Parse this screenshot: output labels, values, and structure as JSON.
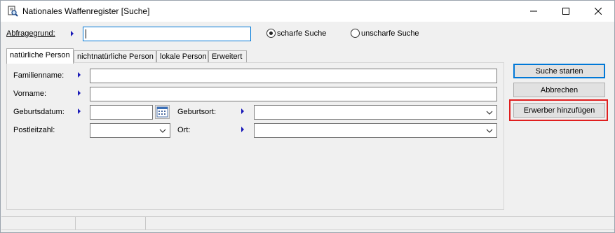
{
  "window": {
    "title": "Nationales Waffenregister [Suche]"
  },
  "query": {
    "label": "Abfragegrund:",
    "value": "",
    "radio_sharp": "scharfe Suche",
    "radio_fuzzy": "unscharfe Suche",
    "selected": "scharfe Suche"
  },
  "tabs": [
    {
      "label": "natürliche Person",
      "active": true
    },
    {
      "label": "nichtnatürliche Person",
      "active": false
    },
    {
      "label": "lokale Person",
      "active": false
    },
    {
      "label": "Erweitert",
      "active": false
    }
  ],
  "form": {
    "familienname_label": "Familienname:",
    "familienname_value": "",
    "vorname_label": "Vorname:",
    "vorname_value": "",
    "geburtsdatum_label": "Geburtsdatum:",
    "geburtsdatum_value": "",
    "geburtsort_label": "Geburtsort:",
    "geburtsort_value": "",
    "postleitzahl_label": "Postleitzahl:",
    "postleitzahl_value": "",
    "ort_label": "Ort:",
    "ort_value": ""
  },
  "buttons": {
    "search": "Suche starten",
    "cancel": "Abbrechen",
    "add_buyer": "Erwerber hinzufügen"
  },
  "colors": {
    "accent": "#0078d7",
    "arrow": "#1a1ab8",
    "highlight": "#e01e1e"
  },
  "icons": {
    "app": "document-magnifier-icon",
    "calendar": "calendar-icon",
    "dropdown": "chevron-down-icon"
  }
}
